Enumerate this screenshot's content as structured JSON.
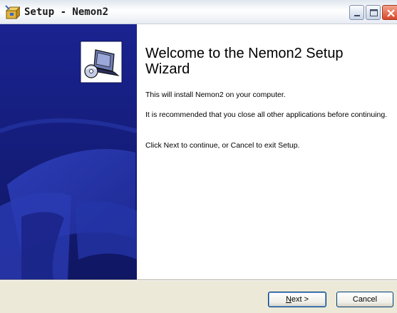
{
  "window": {
    "title": "Setup - Nemon2"
  },
  "content": {
    "heading": "Welcome to the Nemon2 Setup Wizard",
    "paragraphs": [
      "This will install Nemon2 on your computer.",
      "It is recommended that you close all other applications before continuing.",
      "Click Next to continue, or Cancel to exit Setup."
    ]
  },
  "buttons": {
    "next_mnemonic": "N",
    "next_rest": "ext >",
    "cancel": "Cancel"
  },
  "icons": {
    "app": "setup-package-icon",
    "wizard": "computer-install-icon",
    "minimize": "minimize-icon",
    "maximize": "maximize-icon",
    "close": "close-icon"
  },
  "colors": {
    "banner_dark": "#15207a",
    "banner_light": "#3a4fd0",
    "close_button": "#d9472b"
  }
}
